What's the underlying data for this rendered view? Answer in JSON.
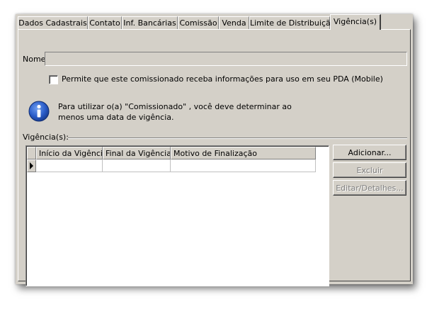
{
  "tabs": [
    {
      "label": "Dados Cadastrais",
      "active": false
    },
    {
      "label": "Contato",
      "active": false
    },
    {
      "label": "Inf. Bancárias",
      "active": false
    },
    {
      "label": "Comissão",
      "active": false
    },
    {
      "label": "Venda",
      "active": false
    },
    {
      "label": "Limite de Distribuição",
      "active": false
    },
    {
      "label": "Vigência(s)",
      "active": true
    }
  ],
  "form": {
    "nome_label": "Nome:",
    "nome_value": "",
    "pda_checkbox_label": "Permite que este comissionado receba informações para uso em seu PDA (Mobile)",
    "pda_checked": false
  },
  "info": {
    "icon": "info-icon",
    "line1": "Para utilizar o(a) \"Comissionado\" , você deve determinar ao",
    "line2": "menos uma data de vigência."
  },
  "vigencias": {
    "group_label": "Vigência(s):",
    "columns": [
      "Início da Vigência",
      "Final da Vigência",
      "Motivo de Finalização"
    ],
    "rows": [
      [
        "",
        "",
        ""
      ]
    ]
  },
  "buttons": {
    "adicionar": "Adicionar...",
    "excluir": "Excluir",
    "editar": "Editar/Detalhes..."
  },
  "colors": {
    "face": "#d4d0c8",
    "info_blue": "#1f54b8"
  }
}
